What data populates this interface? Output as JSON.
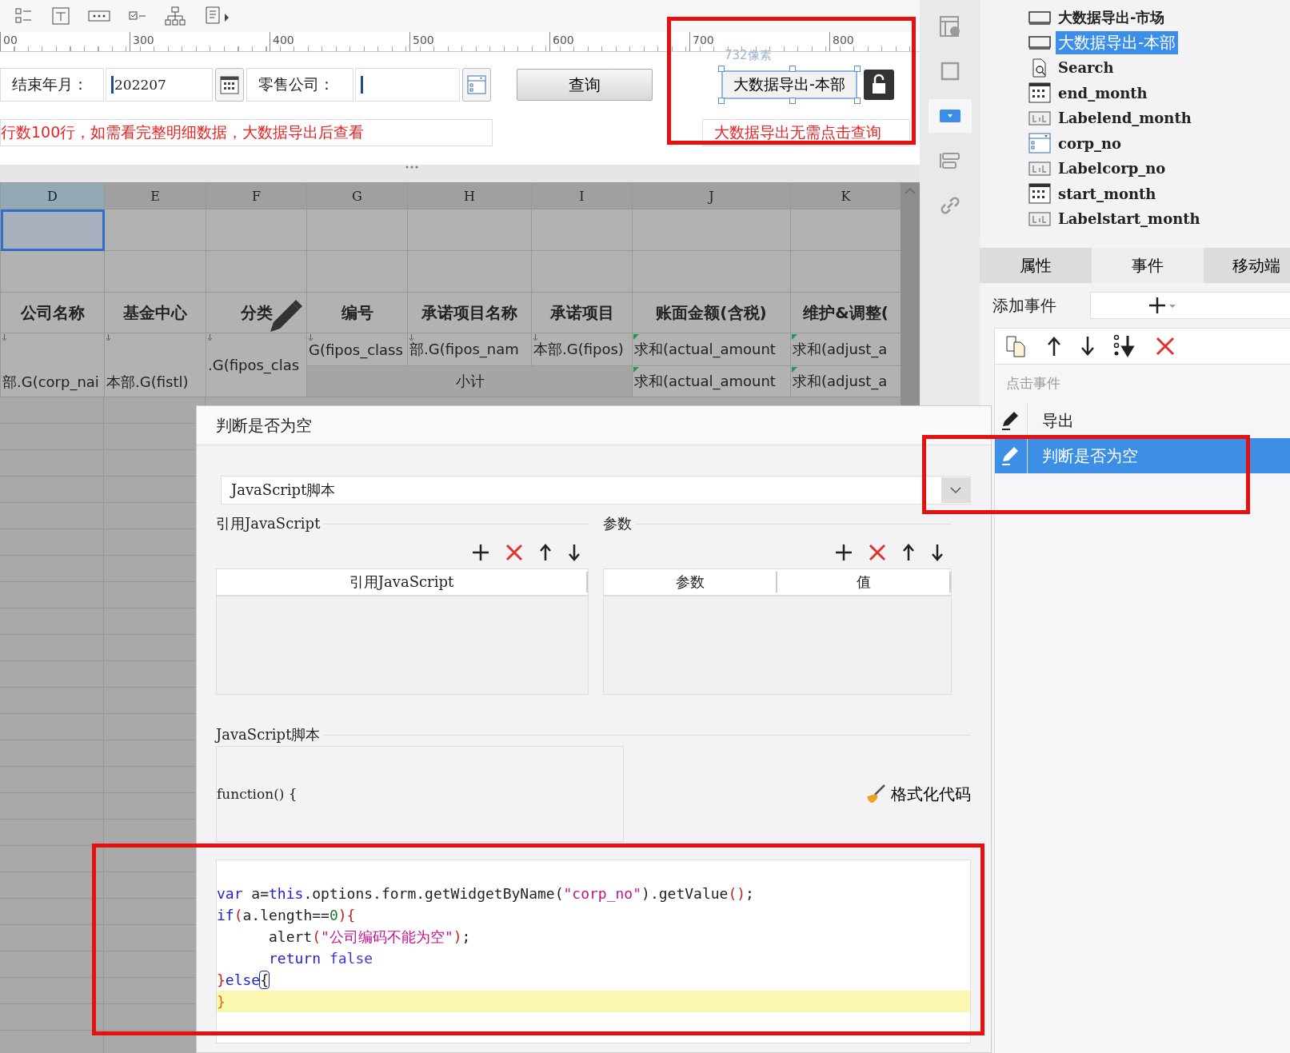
{
  "ruler": {
    "ticks": [
      "00",
      "300",
      "400",
      "500",
      "600",
      "700",
      "800"
    ]
  },
  "form": {
    "end_month": {
      "label": "结束年月：",
      "value": "202207"
    },
    "company": {
      "label": "零售公司："
    },
    "query_button": "查询",
    "selected_widget": {
      "label": "大数据导出-本部",
      "size_hint": "732像素",
      "locked": false
    },
    "notices": [
      "行数100行，如需看完整明细数据，大数据导出后查看",
      "大数据导出无需点击查询"
    ]
  },
  "sheet": {
    "columns": [
      {
        "label": "D",
        "selected": true
      },
      {
        "label": "E",
        "selected": false
      },
      {
        "label": "F",
        "selected": false
      },
      {
        "label": "G",
        "selected": false
      },
      {
        "label": "H",
        "selected": false
      },
      {
        "label": "I",
        "selected": false
      },
      {
        "label": "J",
        "selected": false
      },
      {
        "label": "K",
        "selected": false
      }
    ],
    "header_row": [
      "公司名称",
      "基金中心",
      "分类",
      "编号",
      "承诺项目名称",
      "承诺项目",
      "账面金额(含税)",
      "维护&调整("
    ],
    "row_1": [
      "部.G(corp_nai",
      "本部.G(fistl)",
      ".G(fipos_clas",
      "G(fipos_class",
      "部.G(fipos_nam",
      "本部.G(fipos)",
      "求和(actual_amount",
      "求和(adjust_a"
    ],
    "row_2": [
      "小计",
      "求和(actual_amount",
      "求和(adjust_a"
    ]
  },
  "tool_strip": [
    {
      "selected": false
    },
    {
      "selected": false
    },
    {
      "selected": true
    },
    {
      "selected": false
    },
    {
      "selected": false
    }
  ],
  "widget_tree": [
    {
      "kind": "button",
      "name": "大数据导出-市场",
      "selected": false
    },
    {
      "kind": "button",
      "name": "大数据导出-本部",
      "selected": true
    },
    {
      "kind": "search",
      "name": "Search",
      "selected": false
    },
    {
      "kind": "date",
      "name": "end_month",
      "selected": false
    },
    {
      "kind": "label",
      "name": "Labelend_month",
      "selected": false
    },
    {
      "kind": "combo",
      "name": "corp_no",
      "selected": false
    },
    {
      "kind": "label",
      "name": "Labelcorp_no",
      "selected": false
    },
    {
      "kind": "date",
      "name": "start_month",
      "selected": false
    },
    {
      "kind": "label",
      "name": "Labelstart_month",
      "selected": false
    }
  ],
  "panel_tabs": [
    {
      "label": "属性",
      "selected": false
    },
    {
      "label": "事件",
      "selected": true
    },
    {
      "label": "移动端",
      "selected": false
    }
  ],
  "add_event": {
    "label": "添加事件"
  },
  "event_group": "点击事件",
  "events": [
    {
      "name": "导出",
      "selected": false
    },
    {
      "name": "判断是否为空",
      "selected": true
    }
  ],
  "dialog": {
    "title": "判断是否为空",
    "type_select": "JavaScript脚本",
    "imports": {
      "title": "引用JavaScript",
      "columns": [
        "引用JavaScript"
      ]
    },
    "params": {
      "title": "参数",
      "columns": [
        "参数",
        "值"
      ]
    },
    "script": {
      "title": "JavaScript脚本",
      "signature": "function() {",
      "format_button": "格式化代码",
      "lines": [
        {
          "current": false,
          "tokens": [
            {
              "kind": "keyword",
              "text": "var"
            },
            {
              "kind": "text",
              "text": " a="
            },
            {
              "kind": "keyword",
              "text": "this"
            },
            {
              "kind": "text",
              "text": ".options.form.getWidgetByName("
            },
            {
              "kind": "string",
              "text": "\"corp_no\""
            },
            {
              "kind": "text",
              "text": ").getValue"
            },
            {
              "kind": "bracket",
              "text": "()"
            },
            {
              "kind": "text",
              "text": ";"
            }
          ]
        },
        {
          "current": false,
          "tokens": [
            {
              "kind": "keyword",
              "text": "if"
            },
            {
              "kind": "bracket",
              "text": "("
            },
            {
              "kind": "text",
              "text": "a.length=="
            },
            {
              "kind": "number",
              "text": "0"
            },
            {
              "kind": "bracket",
              "text": "){"
            }
          ]
        },
        {
          "current": false,
          "tokens": [
            {
              "kind": "text",
              "text": "      alert"
            },
            {
              "kind": "bracket",
              "text": "("
            },
            {
              "kind": "string",
              "text": "\"公司编码不能为空\""
            },
            {
              "kind": "bracket",
              "text": ")"
            },
            {
              "kind": "text",
              "text": ";"
            }
          ]
        },
        {
          "current": false,
          "tokens": [
            {
              "kind": "keyword",
              "text": "      return"
            },
            {
              "kind": "literal",
              "text": " false"
            }
          ]
        },
        {
          "current": false,
          "tokens": [
            {
              "kind": "bracket",
              "text": "}"
            },
            {
              "kind": "keyword",
              "text": "else"
            },
            {
              "kind": "match",
              "text": "{"
            }
          ]
        },
        {
          "current": true,
          "tokens": [
            {
              "kind": "brace",
              "text": "}"
            }
          ]
        }
      ]
    }
  }
}
